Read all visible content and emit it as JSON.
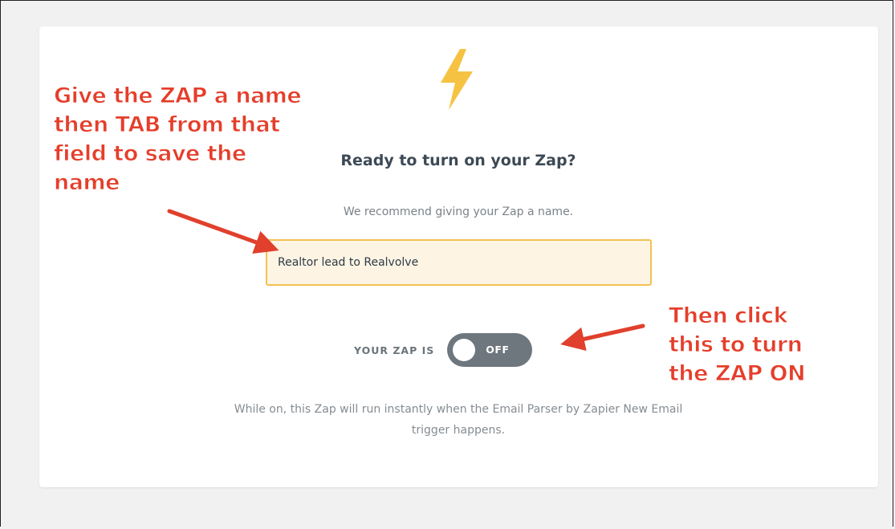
{
  "icon": "lightning-bolt-icon",
  "heading": "Ready to turn on your Zap?",
  "subtext": "We recommend giving your Zap a name.",
  "zap_name": {
    "value": "Realtor lead to Realvolve",
    "placeholder": ""
  },
  "toggle": {
    "label": "YOUR ZAP IS",
    "state": "OFF",
    "is_on": false
  },
  "description": "While on, this Zap will run instantly when the Email Parser by Zapier New Email trigger happens.",
  "annotations": {
    "left": [
      "Give the ZAP a name",
      "then TAB from that",
      "field to save the",
      "name"
    ],
    "right": [
      "Then click",
      "this to turn",
      "the ZAP ON"
    ]
  },
  "colors": {
    "bolt": "#f6c241",
    "input_border": "#f3c153",
    "input_bg": "#fdf4e4",
    "toggle_off": "#6e777e",
    "annotation": "#e53e2b"
  }
}
